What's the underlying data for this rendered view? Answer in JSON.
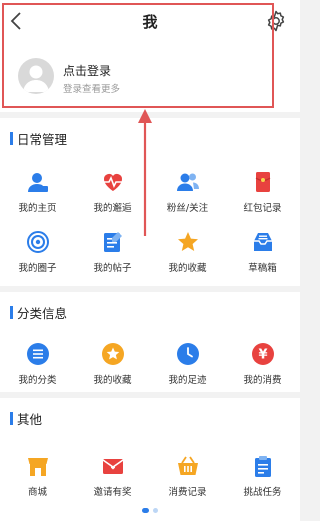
{
  "header": {
    "title": "我"
  },
  "profile": {
    "login_title": "点击登录",
    "login_sub": "登录查看更多"
  },
  "sections": [
    {
      "title": "日常管理",
      "items": [
        {
          "label": "我的主页",
          "icon": "person-icon"
        },
        {
          "label": "我的邂逅",
          "icon": "heartbeat-icon"
        },
        {
          "label": "粉丝/关注",
          "icon": "people-icon"
        },
        {
          "label": "红包记录",
          "icon": "red-envelope-icon"
        },
        {
          "label": "我的圈子",
          "icon": "circle-icon"
        },
        {
          "label": "我的帖子",
          "icon": "post-icon"
        },
        {
          "label": "我的收藏",
          "icon": "star-icon"
        },
        {
          "label": "草稿箱",
          "icon": "drafts-icon"
        }
      ]
    },
    {
      "title": "分类信息",
      "items": [
        {
          "label": "我的分类",
          "icon": "list-icon"
        },
        {
          "label": "我的收藏",
          "icon": "star-badge-icon"
        },
        {
          "label": "我的足迹",
          "icon": "clock-icon"
        },
        {
          "label": "我的消费",
          "icon": "yen-icon"
        }
      ]
    },
    {
      "title": "其他",
      "items": [
        {
          "label": "商城",
          "icon": "shop-icon"
        },
        {
          "label": "邀请有奖",
          "icon": "invite-mail-icon"
        },
        {
          "label": "消费记录",
          "icon": "basket-icon"
        },
        {
          "label": "挑战任务",
          "icon": "clipboard-icon"
        }
      ]
    }
  ],
  "colors": {
    "accent": "#2b7de9",
    "highlight": "#e05656",
    "orange": "#f5a623",
    "red": "#e8423f"
  }
}
